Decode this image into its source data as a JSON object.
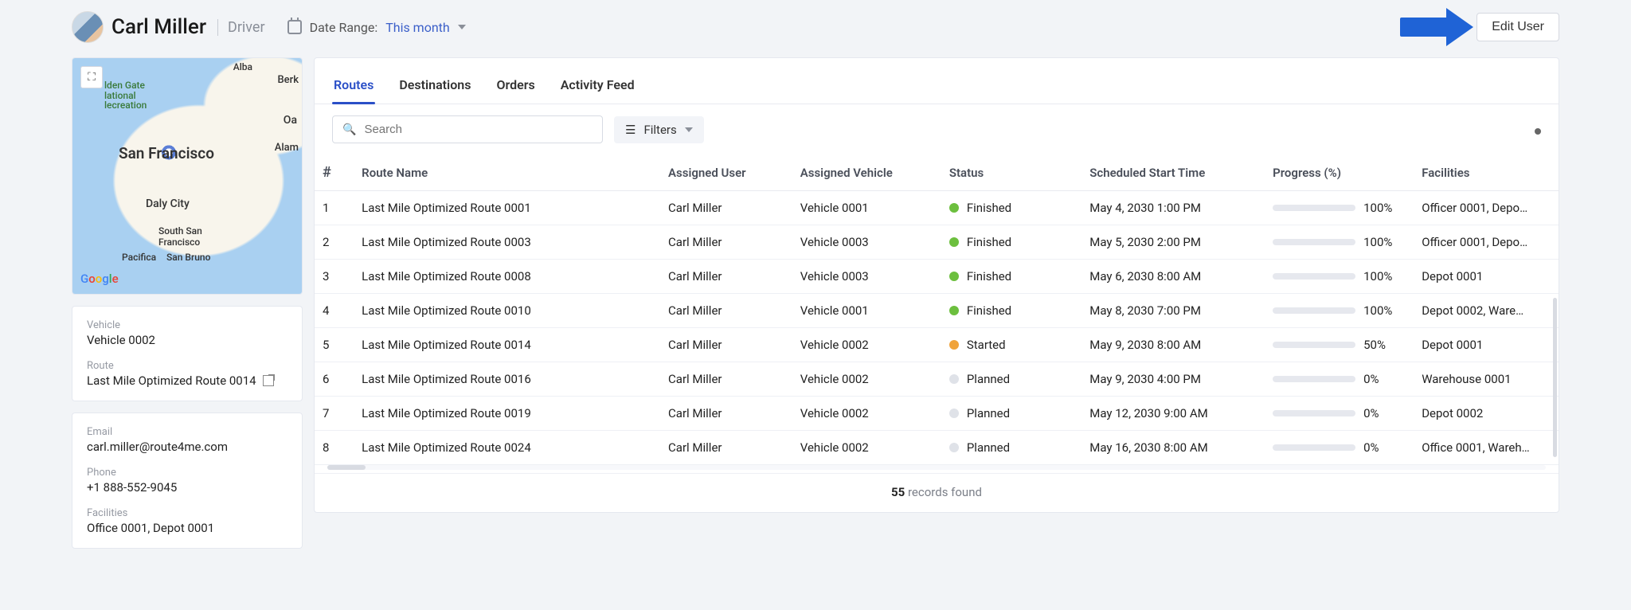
{
  "header": {
    "user_name": "Carl Miller",
    "user_role": "Driver",
    "date_label": "Date Range:",
    "date_value": "This month",
    "edit_user": "Edit User"
  },
  "sidebar": {
    "map": {
      "fullscreen_title": "Fullscreen",
      "city_sf": "San Francisco",
      "city_dc": "Daly City",
      "city_ssf": "South San\nFrancisco",
      "city_pac": "Pacifica",
      "city_sb": "San Bruno",
      "city_alam": "Alam",
      "city_berk": "Berk",
      "city_oak": "Oa",
      "city_alb": "Alba",
      "park_gg": "lden Gate\nlational\nlecreation",
      "logo": "Google"
    },
    "vehicle_label": "Vehicle",
    "vehicle_value": "Vehicle 0002",
    "route_label": "Route",
    "route_value": "Last Mile Optimized Route 0014",
    "email_label": "Email",
    "email_value": "carl.miller@route4me.com",
    "phone_label": "Phone",
    "phone_value": "+1 888-552-9045",
    "facilities_label": "Facilities",
    "facilities_value": "Office 0001, Depot 0001"
  },
  "tabs": [
    "Routes",
    "Destinations",
    "Orders",
    "Activity Feed"
  ],
  "toolbar": {
    "search_placeholder": "Search",
    "filters_label": "Filters"
  },
  "columns": [
    "#",
    "Route Name",
    "Assigned User",
    "Assigned Vehicle",
    "Status",
    "Scheduled Start Time",
    "Progress (%)",
    "Facilities"
  ],
  "rows": [
    {
      "n": "1",
      "name": "Last Mile Optimized Route 0001",
      "user": "Carl Miller",
      "veh": "Vehicle 0001",
      "status": "Finished",
      "dot": "green",
      "time": "May 4, 2030 1:00 PM",
      "pct": 100,
      "fac": "Officer 0001, Depo…"
    },
    {
      "n": "2",
      "name": "Last Mile Optimized Route 0003",
      "user": "Carl Miller",
      "veh": "Vehicle 0003",
      "status": "Finished",
      "dot": "green",
      "time": "May 5, 2030 2:00 PM",
      "pct": 100,
      "fac": "Officer 0001, Depo…"
    },
    {
      "n": "3",
      "name": "Last Mile Optimized Route 0008",
      "user": "Carl Miller",
      "veh": "Vehicle 0003",
      "status": "Finished",
      "dot": "green",
      "time": "May 6, 2030 8:00 AM",
      "pct": 100,
      "fac": "Depot 0001"
    },
    {
      "n": "4",
      "name": "Last Mile Optimized Route 0010",
      "user": "Carl Miller",
      "veh": "Vehicle 0001",
      "status": "Finished",
      "dot": "green",
      "time": "May 8, 2030 7:00 PM",
      "pct": 100,
      "fac": "Depot 0002, Ware…"
    },
    {
      "n": "5",
      "name": "Last Mile Optimized Route 0014",
      "user": "Carl Miller",
      "veh": "Vehicle 0002",
      "status": "Started",
      "dot": "orange",
      "time": "May 9, 2030 8:00 AM",
      "pct": 50,
      "fac": "Depot 0001"
    },
    {
      "n": "6",
      "name": "Last Mile Optimized Route 0016",
      "user": "Carl Miller",
      "veh": "Vehicle 0002",
      "status": "Planned",
      "dot": "grey",
      "time": "May 9, 2030 4:00 PM",
      "pct": 0,
      "fac": "Warehouse 0001"
    },
    {
      "n": "7",
      "name": "Last Mile Optimized Route 0019",
      "user": "Carl Miller",
      "veh": "Vehicle 0002",
      "status": "Planned",
      "dot": "grey",
      "time": "May 12, 2030 9:00 AM",
      "pct": 0,
      "fac": "Depot 0002"
    },
    {
      "n": "8",
      "name": "Last Mile Optimized Route 0024",
      "user": "Carl Miller",
      "veh": "Vehicle 0002",
      "status": "Planned",
      "dot": "grey",
      "time": "May 16, 2030 8:00 AM",
      "pct": 0,
      "fac": "Office 0001, Wareh…"
    }
  ],
  "footer": {
    "count": "55",
    "suffix": " records found"
  }
}
